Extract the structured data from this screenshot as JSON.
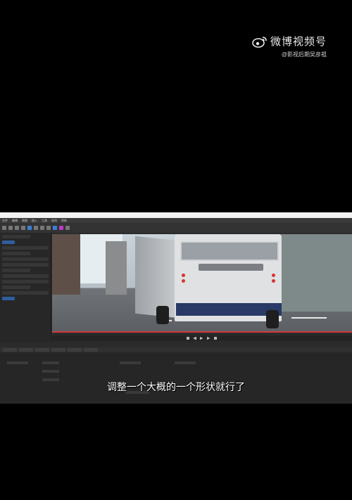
{
  "watermark": {
    "title": "微博视频号",
    "handle": "@影视后期吴彦祖"
  },
  "app": {
    "menu": [
      "文件",
      "编辑",
      "视图",
      "插入",
      "工具",
      "选项",
      "帮助"
    ]
  },
  "subtitle": "调整一个大概的一个形状就行了",
  "colors": {
    "accent": "#3b7fd6",
    "progress": "#d23b3b",
    "magenta_tool": "#c23bc2"
  }
}
